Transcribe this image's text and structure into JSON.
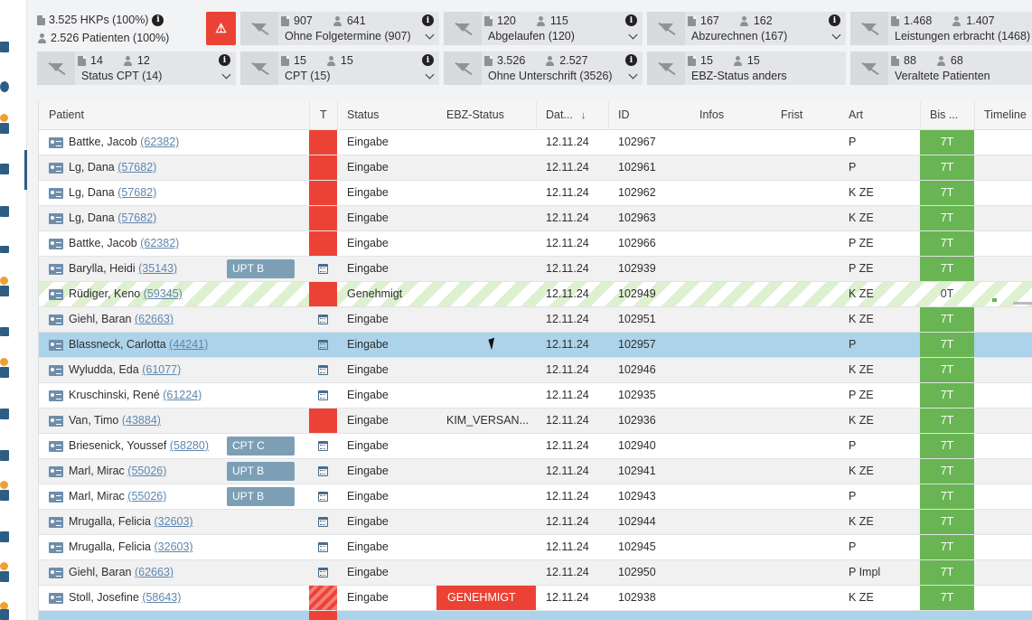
{
  "summary": {
    "hkps": "3.525 HKPs (100%)",
    "patients": "2.526 Patienten (100%)"
  },
  "filters": [
    {
      "docs": "907",
      "users": "641",
      "label": "Ohne Folgetermine (907)",
      "info": true,
      "chevron": true
    },
    {
      "docs": "120",
      "users": "115",
      "label": "Abgelaufen (120)",
      "info": true,
      "chevron": true
    },
    {
      "docs": "167",
      "users": "162",
      "label": "Abzurechnen (167)",
      "info": true,
      "chevron": true
    },
    {
      "docs": "1.468",
      "users": "1.407",
      "label": "Leistungen erbracht (1468)",
      "info": false,
      "chevron": false
    },
    {
      "docs": "14",
      "users": "12",
      "label": "Status CPT (14)",
      "info": true,
      "chevron": true
    },
    {
      "docs": "15",
      "users": "15",
      "label": "CPT (15)",
      "info": true,
      "chevron": true
    },
    {
      "docs": "3.526",
      "users": "2.527",
      "label": "Ohne Unterschrift (3526)",
      "info": true,
      "chevron": true
    },
    {
      "docs": "15",
      "users": "15",
      "label": "EBZ-Status anders",
      "info": false,
      "chevron": false
    },
    {
      "docs": "88",
      "users": "68",
      "label": "Veraltete Patienten",
      "info": false,
      "chevron": false
    }
  ],
  "table": {
    "columns": {
      "patient": "Patient",
      "t": "T",
      "status": "Status",
      "ebz": "EBZ-Status",
      "date": "Dat...",
      "id": "ID",
      "infos": "Infos",
      "frist": "Frist",
      "art": "Art",
      "bis": "Bis ...",
      "timeline": "Timeline"
    },
    "sort_indicator": "↓",
    "rows": [
      {
        "name": "Battke, Jacob",
        "pid": "(62382)",
        "tag": "",
        "t": "red",
        "status": "Eingabe",
        "ebz": "",
        "ebz_badge": false,
        "date": "12.11.24",
        "id": "102967",
        "art": "P",
        "bis": "7T"
      },
      {
        "name": "Lg, Dana",
        "pid": "(57682)",
        "tag": "",
        "t": "red",
        "status": "Eingabe",
        "ebz": "",
        "ebz_badge": false,
        "date": "12.11.24",
        "id": "102961",
        "art": "P",
        "bis": "7T"
      },
      {
        "name": "Lg, Dana",
        "pid": "(57682)",
        "tag": "",
        "t": "red",
        "status": "Eingabe",
        "ebz": "",
        "ebz_badge": false,
        "date": "12.11.24",
        "id": "102962",
        "art": "K ZE",
        "bis": "7T"
      },
      {
        "name": "Lg, Dana",
        "pid": "(57682)",
        "tag": "",
        "t": "red",
        "status": "Eingabe",
        "ebz": "",
        "ebz_badge": false,
        "date": "12.11.24",
        "id": "102963",
        "art": "K ZE",
        "bis": "7T"
      },
      {
        "name": "Battke, Jacob",
        "pid": "(62382)",
        "tag": "",
        "t": "red",
        "status": "Eingabe",
        "ebz": "",
        "ebz_badge": false,
        "date": "12.11.24",
        "id": "102966",
        "art": "P ZE",
        "bis": "7T"
      },
      {
        "name": "Barylla, Heidi",
        "pid": "(35143)",
        "tag": "UPT B",
        "t": "calendar",
        "status": "Eingabe",
        "ebz": "",
        "ebz_badge": false,
        "date": "12.11.24",
        "id": "102939",
        "art": "P ZE",
        "bis": "7T"
      },
      {
        "name": "Rüdiger, Keno",
        "pid": "(59345)",
        "tag": "",
        "t": "red",
        "status": "Genehmigt",
        "ebz": "",
        "ebz_badge": false,
        "date": "12.11.24",
        "id": "102949",
        "art": "K ZE",
        "bis": "0T",
        "striped": true
      },
      {
        "name": "Giehl, Baran",
        "pid": "(62663)",
        "tag": "",
        "t": "calendar",
        "status": "Eingabe",
        "ebz": "",
        "ebz_badge": false,
        "date": "12.11.24",
        "id": "102951",
        "art": "K ZE",
        "bis": "7T"
      },
      {
        "name": "Blassneck, Carlotta",
        "pid": "(44241)",
        "tag": "",
        "t": "calendar",
        "status": "Eingabe",
        "ebz": "",
        "ebz_badge": false,
        "date": "12.11.24",
        "id": "102957",
        "art": "P",
        "bis": "7T",
        "selected": true
      },
      {
        "name": "Wyludda, Eda",
        "pid": "(61077)",
        "tag": "",
        "t": "calendar",
        "status": "Eingabe",
        "ebz": "",
        "ebz_badge": false,
        "date": "12.11.24",
        "id": "102946",
        "art": "K ZE",
        "bis": "7T"
      },
      {
        "name": "Kruschinski, René",
        "pid": "(61224)",
        "tag": "",
        "t": "calendar",
        "status": "Eingabe",
        "ebz": "",
        "ebz_badge": false,
        "date": "12.11.24",
        "id": "102935",
        "art": "P ZE",
        "bis": "7T"
      },
      {
        "name": "Van, Timo",
        "pid": "(43884)",
        "tag": "",
        "t": "red",
        "status": "Eingabe",
        "ebz": "KIM_VERSAN...",
        "ebz_badge": false,
        "date": "12.11.24",
        "id": "102936",
        "art": "K ZE",
        "bis": "7T"
      },
      {
        "name": "Briesenick, Youssef",
        "pid": "(58280)",
        "tag": "CPT C",
        "t": "calendar",
        "status": "Eingabe",
        "ebz": "",
        "ebz_badge": false,
        "date": "12.11.24",
        "id": "102940",
        "art": "P",
        "bis": "7T"
      },
      {
        "name": "Marl, Mirac",
        "pid": "(55026)",
        "tag": "UPT B",
        "t": "calendar",
        "status": "Eingabe",
        "ebz": "",
        "ebz_badge": false,
        "date": "12.11.24",
        "id": "102941",
        "art": "K ZE",
        "bis": "7T"
      },
      {
        "name": "Marl, Mirac",
        "pid": "(55026)",
        "tag": "UPT B",
        "t": "calendar",
        "status": "Eingabe",
        "ebz": "",
        "ebz_badge": false,
        "date": "12.11.24",
        "id": "102943",
        "art": "P",
        "bis": "7T"
      },
      {
        "name": "Mrugalla, Felicia",
        "pid": "(32603)",
        "tag": "",
        "t": "calendar",
        "status": "Eingabe",
        "ebz": "",
        "ebz_badge": false,
        "date": "12.11.24",
        "id": "102944",
        "art": "K ZE",
        "bis": "7T"
      },
      {
        "name": "Mrugalla, Felicia",
        "pid": "(32603)",
        "tag": "",
        "t": "calendar",
        "status": "Eingabe",
        "ebz": "",
        "ebz_badge": false,
        "date": "12.11.24",
        "id": "102945",
        "art": "P",
        "bis": "7T"
      },
      {
        "name": "Giehl, Baran",
        "pid": "(62663)",
        "tag": "",
        "t": "calendar",
        "status": "Eingabe",
        "ebz": "",
        "ebz_badge": false,
        "date": "12.11.24",
        "id": "102950",
        "art": "P Impl",
        "bis": "7T"
      },
      {
        "name": "Stoll, Josefine",
        "pid": "(58643)",
        "tag": "",
        "t": "red-hatched",
        "status": "Eingabe",
        "ebz": "GENEHMIGT",
        "ebz_badge": true,
        "date": "12.11.24",
        "id": "102938",
        "art": "K ZE",
        "bis": "7T"
      }
    ]
  },
  "colors": {
    "red": "#ec4235",
    "green": "#69b553",
    "selected": "#acd3ea",
    "tag": "#7d9fb5",
    "link": "#5f86ad"
  }
}
